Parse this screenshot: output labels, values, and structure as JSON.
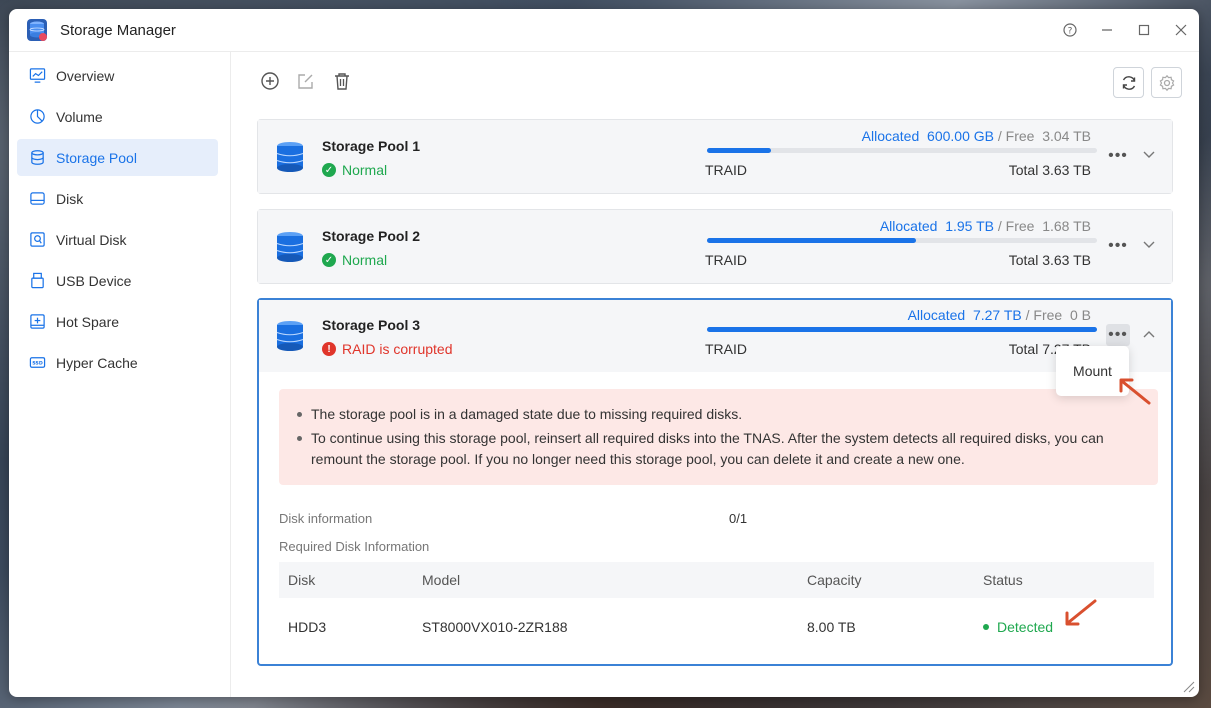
{
  "window": {
    "title": "Storage Manager"
  },
  "sidebar": {
    "items": [
      {
        "label": "Overview",
        "icon": "monitor-chart-icon"
      },
      {
        "label": "Volume",
        "icon": "pie-icon"
      },
      {
        "label": "Storage Pool",
        "icon": "database-icon",
        "active": true
      },
      {
        "label": "Disk",
        "icon": "hard-disk-icon"
      },
      {
        "label": "Virtual Disk",
        "icon": "virtual-disk-icon"
      },
      {
        "label": "USB Device",
        "icon": "usb-icon"
      },
      {
        "label": "Hot Spare",
        "icon": "hot-spare-icon"
      },
      {
        "label": "Hyper Cache",
        "icon": "ssd-icon"
      }
    ]
  },
  "pools": [
    {
      "name": "Storage Pool 1",
      "status": "Normal",
      "status_type": "ok",
      "allocated_label": "Allocated",
      "allocated": "600.00 GB",
      "free_label": "/ Free",
      "free": "3.04 TB",
      "usage_fraction": 0.165,
      "raid": "TRAID",
      "total": "Total 3.63 TB"
    },
    {
      "name": "Storage Pool 2",
      "status": "Normal",
      "status_type": "ok",
      "allocated_label": "Allocated",
      "allocated": "1.95 TB",
      "free_label": "/ Free",
      "free": "1.68 TB",
      "usage_fraction": 0.537,
      "raid": "TRAID",
      "total": "Total 3.63 TB"
    },
    {
      "name": "Storage Pool 3",
      "status": "RAID is corrupted",
      "status_type": "err",
      "allocated_label": "Allocated",
      "allocated": "7.27 TB",
      "free_label": "/ Free",
      "free": "0 B",
      "usage_fraction": 1.0,
      "raid": "TRAID",
      "total": "Total 7.27 TB"
    }
  ],
  "alert": {
    "lines": [
      "The storage pool is in a damaged state due to missing required disks.",
      "To continue using this storage pool, reinsert all required disks into the TNAS. After the system detects all required disks, you can remount the storage pool. If you no longer need this storage pool, you can delete it and create a new one."
    ]
  },
  "disk_info": {
    "label": "Disk information",
    "value": "0/1",
    "required_label": "Required Disk Information"
  },
  "table": {
    "headers": [
      "Disk",
      "Model",
      "Capacity",
      "Status"
    ],
    "rows": [
      {
        "disk": "HDD3",
        "model": "ST8000VX010-2ZR188",
        "capacity": "8.00 TB",
        "status": "Detected"
      }
    ]
  },
  "menu": {
    "mount": "Mount"
  },
  "colors": {
    "accent": "#1a73e8",
    "ok": "#1fa84f",
    "error": "#e0352b",
    "arrow": "#d9502f"
  }
}
